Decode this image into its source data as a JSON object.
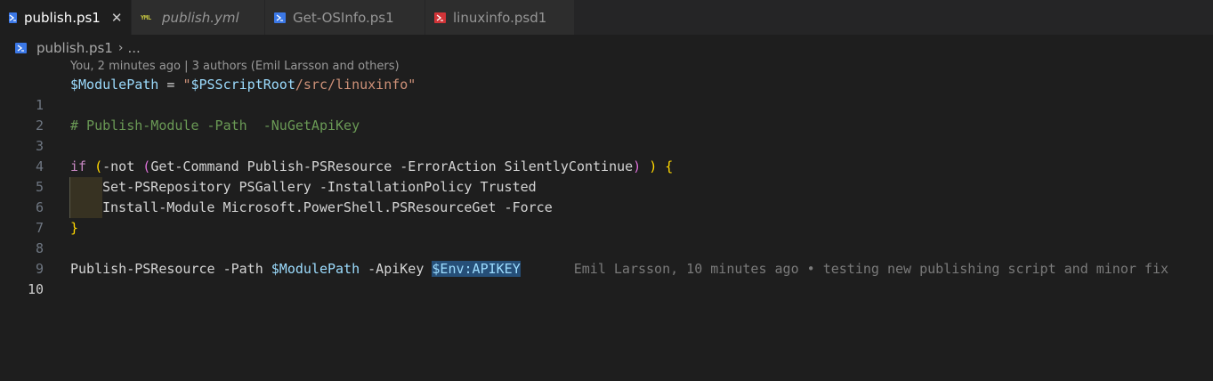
{
  "tabs": [
    {
      "label": "publish.ps1",
      "icon": "powershell-file-icon",
      "active": true,
      "close": "✕"
    },
    {
      "label": "publish.yml",
      "icon": "yaml-file-icon",
      "italic": true
    },
    {
      "label": "Get-OSInfo.ps1",
      "icon": "powershell-file-icon"
    },
    {
      "label": "linuxinfo.psd1",
      "icon": "powershell-data-file-icon"
    }
  ],
  "breadcrumb": {
    "file": "publish.ps1",
    "separator": "›",
    "more": "..."
  },
  "codelens": "You, 2 minutes ago | 3 authors (Emil Larsson and others)",
  "lines": {
    "n1": "1",
    "n2": "2",
    "n3": "3",
    "n4": "4",
    "n5": "5",
    "n6": "6",
    "n7": "7",
    "n8": "8",
    "n9": "9",
    "n10": "10",
    "l1_var": "$ModulePath",
    "l1_eq": " = ",
    "l1_str_open": "\"",
    "l1_str_var": "$PSScriptRoot",
    "l1_str_rest": "/src/linuxinfo\"",
    "l3_comment": "# Publish-Module -Path  -NuGetApiKey",
    "l5_if": "if",
    "l5_open1": " (",
    "l5_not": "-not ",
    "l5_open2": "(",
    "l5_body": "Get-Command Publish-PSResource -ErrorAction SilentlyContinue",
    "l5_close2": ")",
    "l5_close1": " )",
    "l5_brace": " {",
    "l6": "Set-PSRepository PSGallery -InstallationPolicy Trusted",
    "l7": "Install-Module Microsoft.PowerShell.PSResourceGet -Force",
    "l8_brace": "}",
    "l10_cmd": "Publish-PSResource -Path ",
    "l10_var1": "$ModulePath",
    "l10_mid": " -ApiKey ",
    "l10_var2": "$Env:APIKEY",
    "l10_blame": "Emil Larsson, 10 minutes ago • testing new publishing script and minor fix"
  }
}
